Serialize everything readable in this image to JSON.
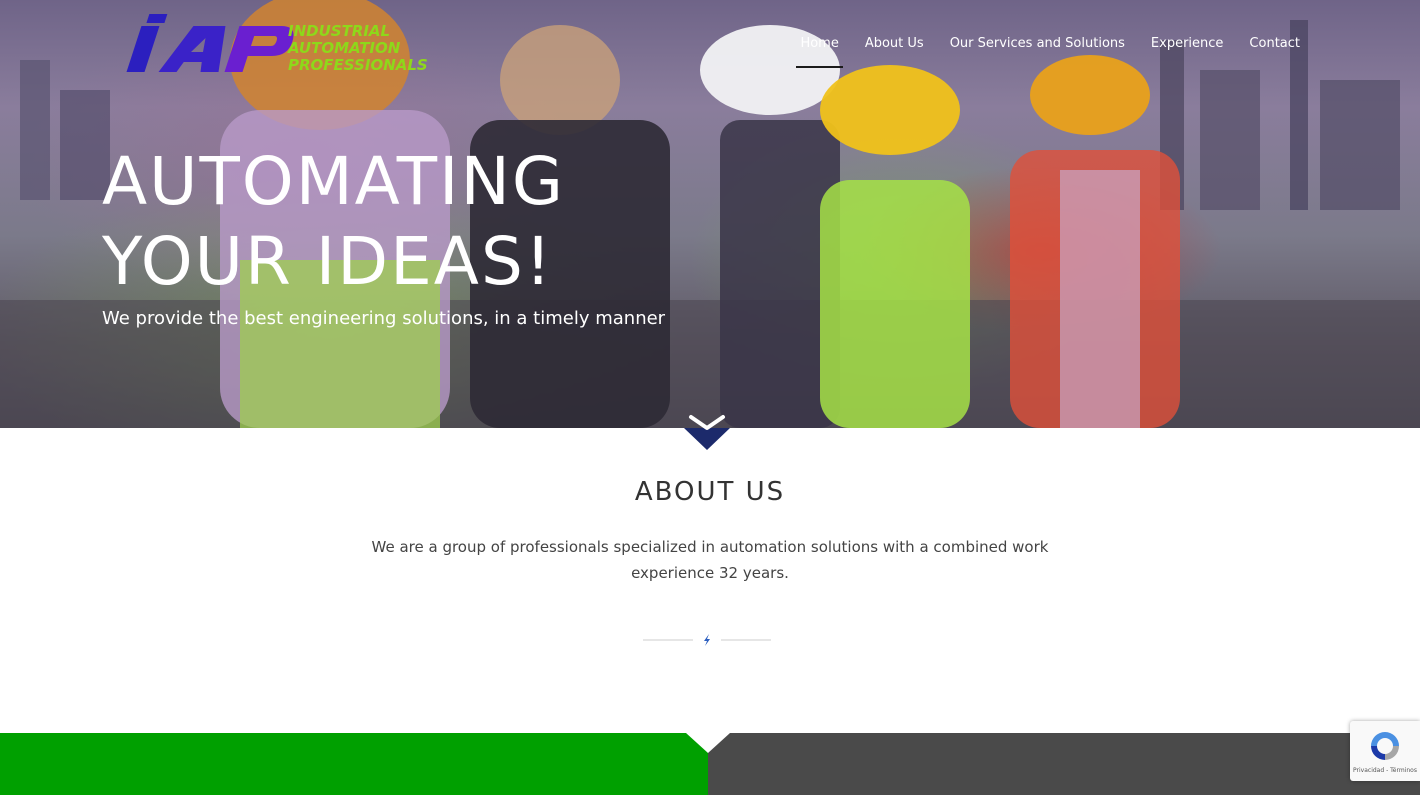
{
  "brand": {
    "logo_letters": "IAP",
    "logo_lines": [
      "INDUSTRIAL",
      "AUTOMATION",
      "PROFESSIONALS"
    ],
    "colors": {
      "logo_blue": "#2b1fbf",
      "logo_purple": "#6a1fd0",
      "logo_green": "#8ed81a"
    }
  },
  "nav": {
    "items": [
      "Home",
      "About Us",
      "Our Services and Solutions",
      "Experience",
      "Contact"
    ],
    "active": "Home"
  },
  "hero": {
    "headline_line1": "AUTOMATING",
    "headline_line2": "YOUR IDEAS!",
    "subline": "We provide the best engineering solutions, in a timely manner",
    "scroll_icon": "chevron-down-icon"
  },
  "about": {
    "title": "ABOUT US",
    "text": "We are a group of professionals specialized in automation solutions with a combined work experience 32 years.",
    "divider_icon": "lightning-bolt-icon"
  },
  "panels": {
    "colors": {
      "left": "#00a000",
      "right": "#4a4a4a"
    }
  },
  "recaptcha": {
    "label": "Privacidad - Términos",
    "icon": "recaptcha-icon"
  }
}
